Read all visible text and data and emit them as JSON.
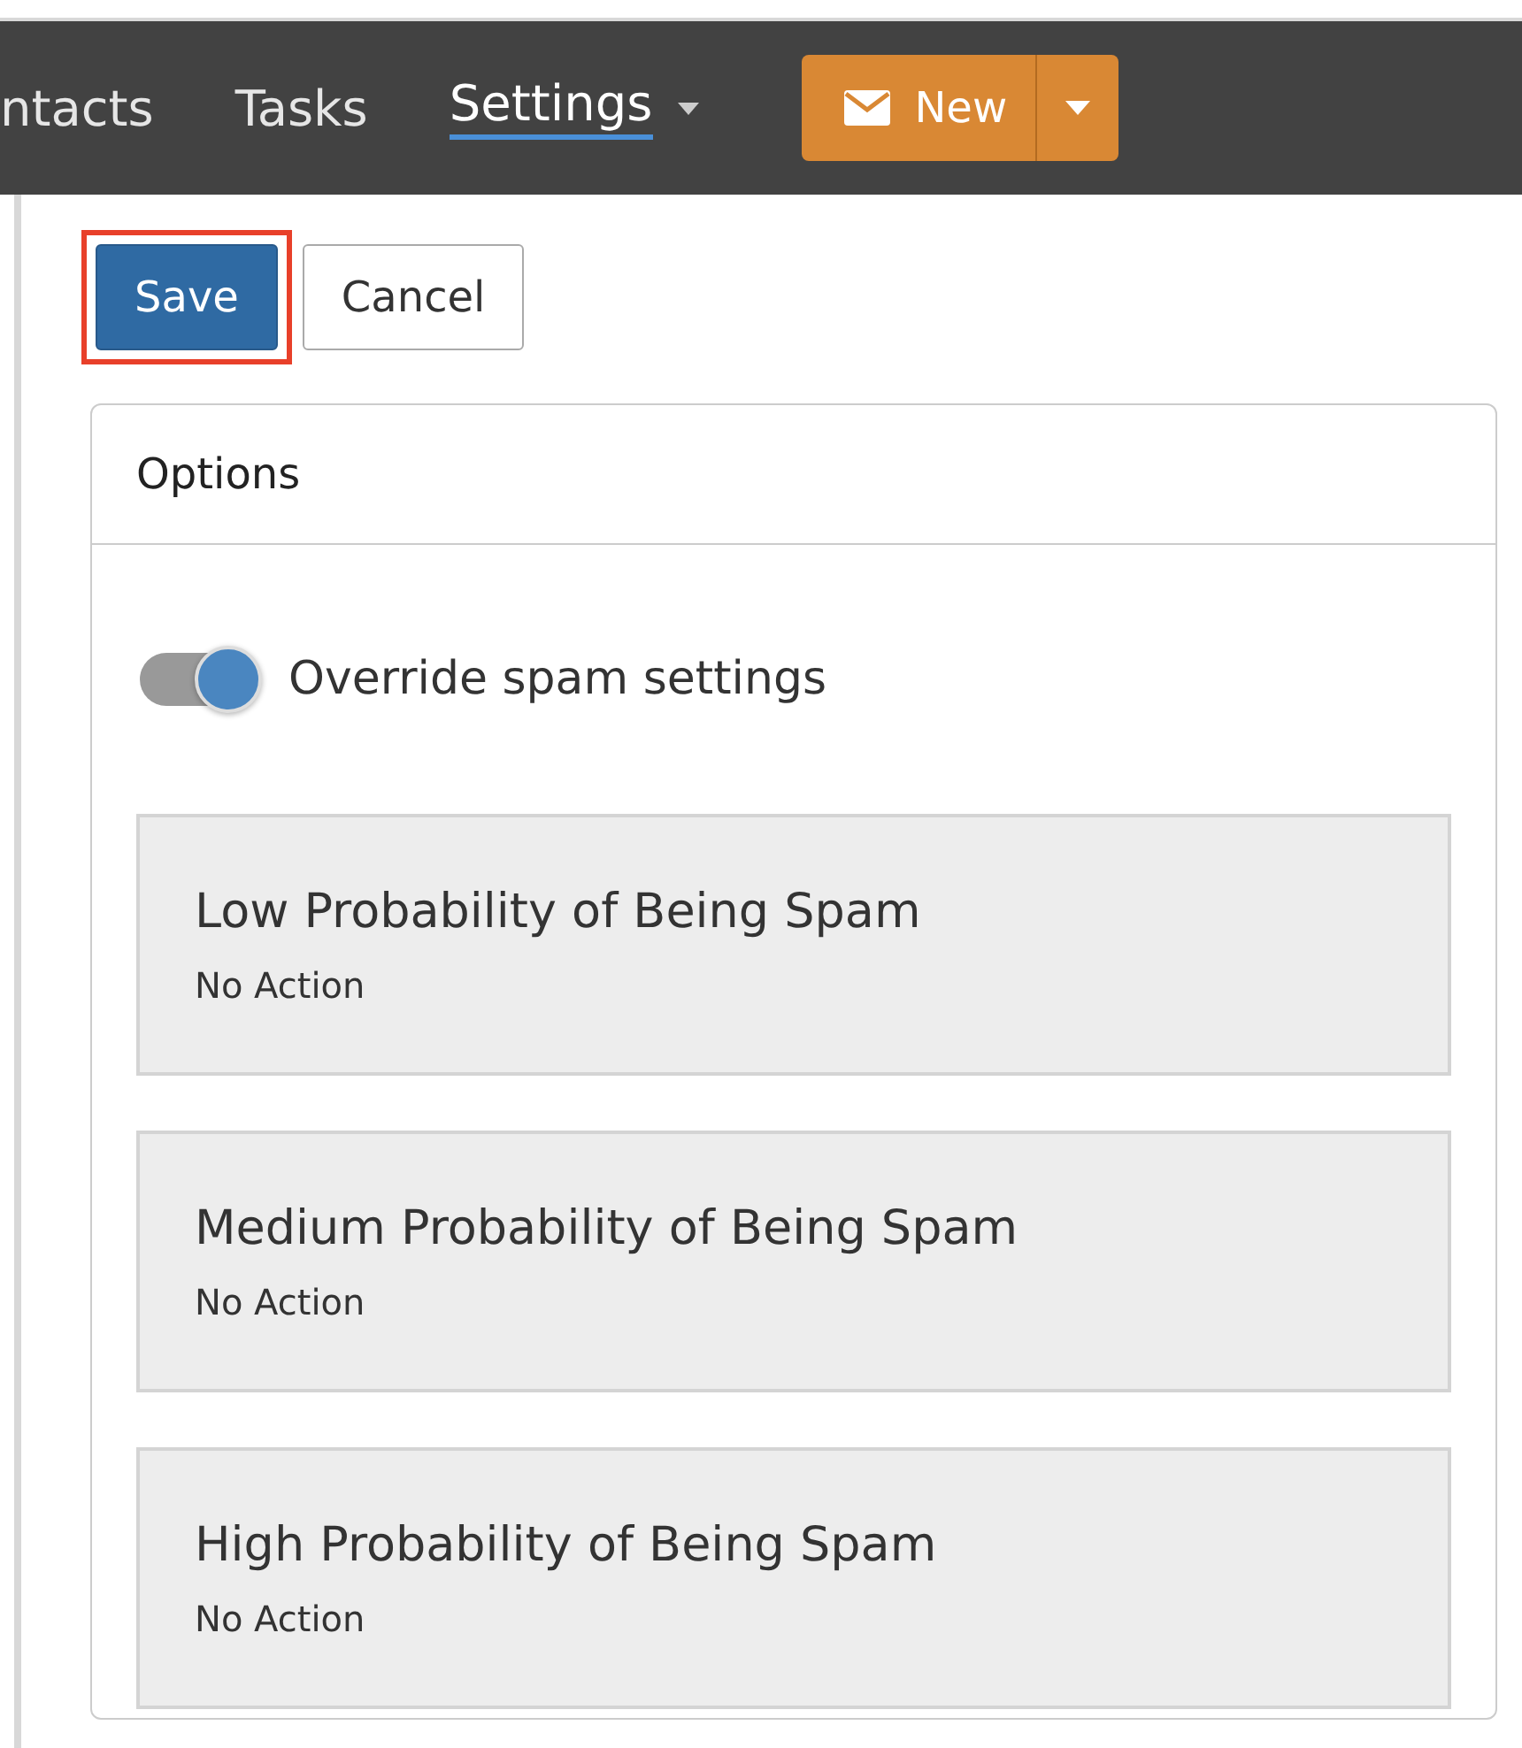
{
  "nav": {
    "items": [
      {
        "label": "ntacts",
        "selected": false,
        "dropdown": false
      },
      {
        "label": "Tasks",
        "selected": false,
        "dropdown": false
      },
      {
        "label": "Settings",
        "selected": true,
        "dropdown": true
      }
    ],
    "new_button": {
      "label": "New"
    }
  },
  "actions": [
    {
      "label": "Save",
      "kind": "primary",
      "highlighted": true
    },
    {
      "label": "Cancel",
      "kind": "secondary",
      "highlighted": false
    }
  ],
  "options": {
    "title": "Options",
    "toggle": {
      "label": "Override spam settings",
      "on": true
    },
    "levels": [
      {
        "title": "Low Probability of Being Spam",
        "action": "No Action"
      },
      {
        "title": "Medium Probability of Being Spam",
        "action": "No Action"
      },
      {
        "title": "High Probability of Being Spam",
        "action": "No Action"
      }
    ]
  }
}
